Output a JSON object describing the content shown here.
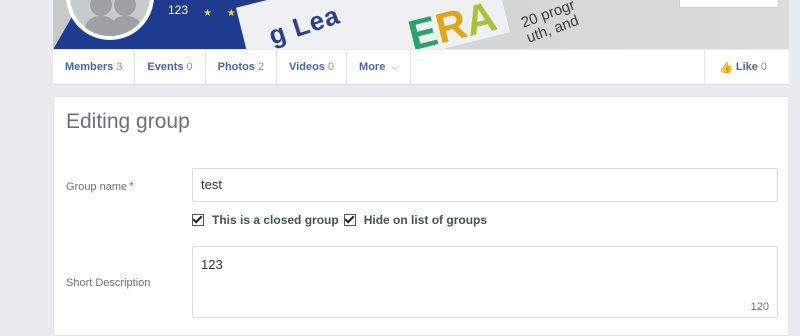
{
  "group": {
    "member_count_badge": "123"
  },
  "nav": {
    "items": [
      {
        "label": "Members",
        "count": "3"
      },
      {
        "label": "Events",
        "count": "0"
      },
      {
        "label": "Photos",
        "count": "2"
      },
      {
        "label": "Videos",
        "count": "0"
      }
    ],
    "more_label": "More",
    "like_label": "Like",
    "like_count": "0"
  },
  "form": {
    "title": "Editing group",
    "group_name_label": "Group name",
    "required_mark": "*",
    "group_name_value": "test",
    "closed_group_label": "This is a closed group",
    "hide_label": "Hide on list of groups",
    "short_description_label": "Short Description",
    "short_description_value": "123",
    "char_counter": "120"
  },
  "colors": {
    "link_blue": "#4b67a1",
    "required_red": "#e64949",
    "page_bg": "#e9ebee"
  }
}
